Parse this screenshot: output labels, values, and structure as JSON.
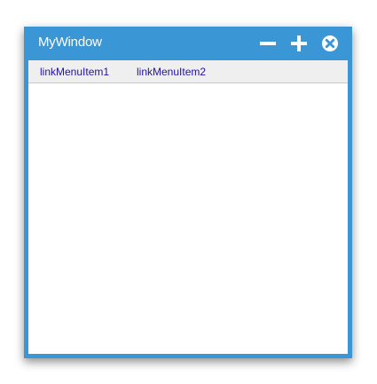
{
  "window": {
    "title": "MyWindow",
    "accent_color": "#3a96d4",
    "controls": {
      "minimize_icon": "minus-icon",
      "maximize_icon": "plus-icon",
      "close_icon": "close-circle-icon"
    }
  },
  "menu": {
    "items": [
      {
        "label": "linkMenuItem1"
      },
      {
        "label": "linkMenuItem2"
      }
    ],
    "link_color": "#2211aa"
  }
}
